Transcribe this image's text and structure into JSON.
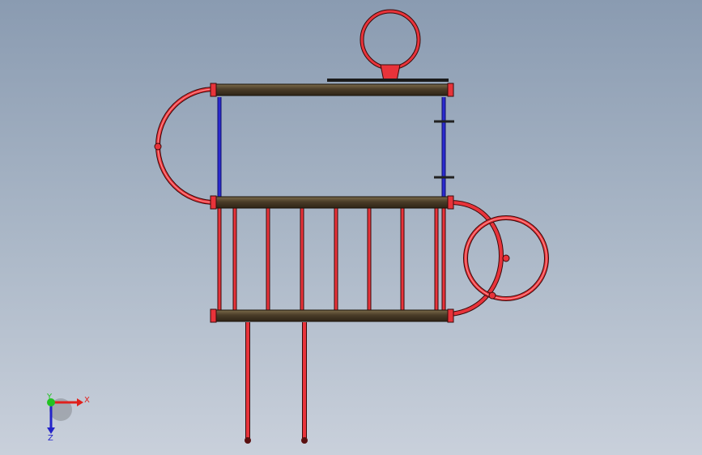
{
  "triad": {
    "x_label": "X",
    "y_label": "Y",
    "z_label": "Z",
    "x_color": "#e0201c",
    "y_color": "#21c321",
    "z_color": "#2323c9"
  },
  "colors": {
    "frame_beam": "#4a3c28",
    "beam_highlight": "#7a6a4a",
    "tube_red": "#e8333a",
    "tube_red_light": "#ff9a9a",
    "tube_blue": "#2a2ad0",
    "outline": "#3a0a0a"
  }
}
